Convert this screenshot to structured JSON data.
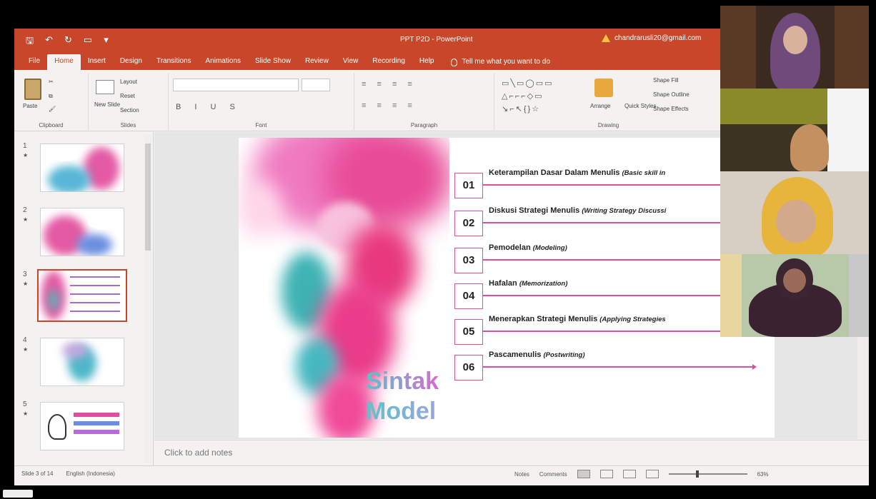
{
  "window": {
    "title": "PPT P2D - PowerPoint",
    "account": "chandrarusli20@gmail.com"
  },
  "tabs": [
    "File",
    "Home",
    "Insert",
    "Design",
    "Transitions",
    "Animations",
    "Slide Show",
    "Review",
    "View",
    "Recording",
    "Help"
  ],
  "active_tab": "Home",
  "tellme": "Tell me what you want to do",
  "ribbon": {
    "clipboard": {
      "paste": "Paste",
      "label": "Clipboard"
    },
    "slides": {
      "new_slide": "New Slide",
      "layout": "Layout",
      "reset": "Reset",
      "section": "Section",
      "label": "Slides"
    },
    "font": {
      "label": "Font"
    },
    "paragraph": {
      "label": "Paragraph"
    },
    "drawing": {
      "arrange": "Arrange",
      "quick_styles": "Quick Styles",
      "shape_fill": "Shape Fill",
      "shape_outline": "Shape Outline",
      "shape_effects": "Shape Effects",
      "label": "Drawing"
    }
  },
  "thumbnails": [
    {
      "num": "1",
      "star": "★"
    },
    {
      "num": "2",
      "star": "★"
    },
    {
      "num": "3",
      "star": "★"
    },
    {
      "num": "4",
      "star": "★"
    },
    {
      "num": "5",
      "star": "★"
    }
  ],
  "slide": {
    "heading_line1": "Sintak",
    "heading_line2": "Model",
    "steps": [
      {
        "num": "01",
        "text": "Keterampilan Dasar Dalam Menulis",
        "italic": "(Basic skill in"
      },
      {
        "num": "02",
        "text": "Diskusi Strategi Menulis",
        "italic": "(Writing Strategy Discussi"
      },
      {
        "num": "03",
        "text": "Pemodelan",
        "italic": "(Modeling)"
      },
      {
        "num": "04",
        "text": "Hafalan",
        "italic": "(Memorization)"
      },
      {
        "num": "05",
        "text": "Menerapkan Strategi Menulis",
        "italic": "(Applying Strategies"
      },
      {
        "num": "06",
        "text": "Pascamenulis",
        "italic": "(Postwriting)"
      }
    ]
  },
  "notes_placeholder": "Click to add notes",
  "status": {
    "slide_of": "Slide 3 of 14",
    "language": "English (Indonesia)",
    "notes": "Notes",
    "comments": "Comments",
    "zoom": "63%"
  },
  "colors": {
    "accent": "#c8472b",
    "step_border": "#e04e9b"
  }
}
